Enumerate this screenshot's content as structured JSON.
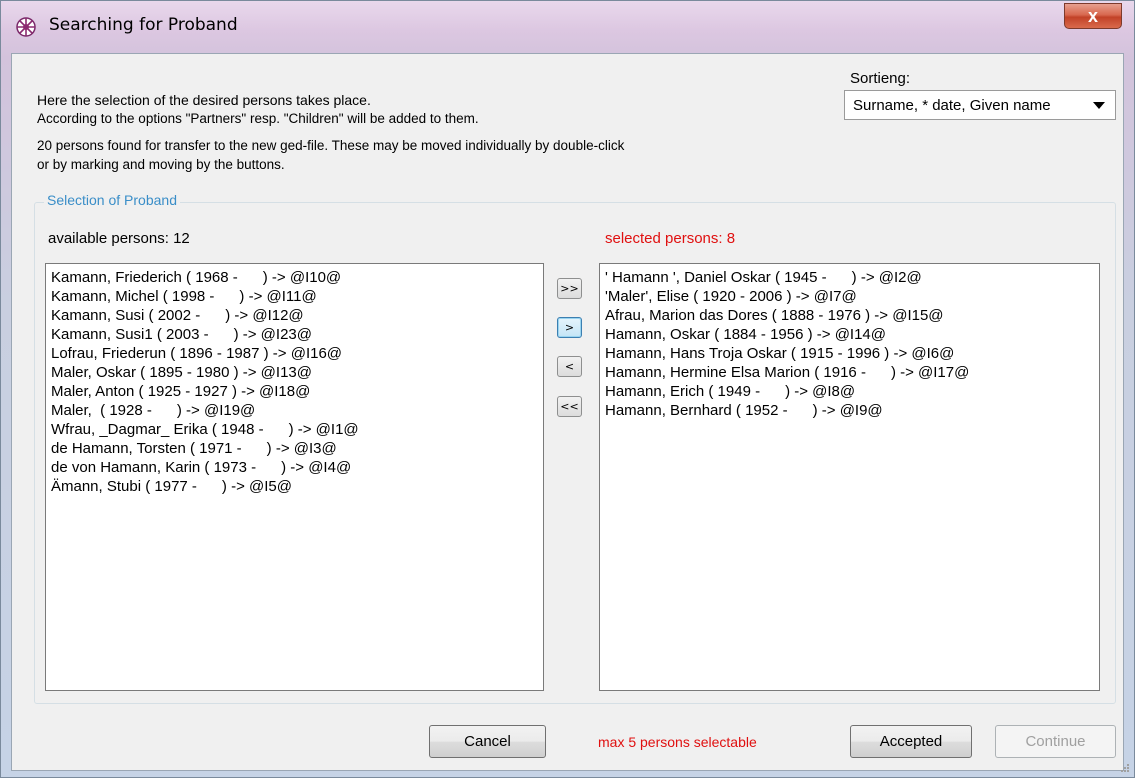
{
  "window": {
    "title": "Searching for Proband",
    "close_glyph": "x"
  },
  "info": {
    "line1": "Here the selection of the desired persons takes place.",
    "line2": "According to the options \"Partners\" resp. \"Children\" will be added to them.",
    "line3": "20 persons found for transfer to the new ged-file. These may be moved individually by double-click",
    "line4": "or by marking and moving by the buttons."
  },
  "sort": {
    "label": "Sortieng:",
    "value": "Surname, * date, Given name"
  },
  "group": {
    "title": "Selection of Proband"
  },
  "available": {
    "label": "available persons: 12",
    "items": [
      "Kamann, Friederich ( 1968 -      ) -> @I10@",
      "Kamann, Michel ( 1998 -      ) -> @I11@",
      "Kamann, Susi ( 2002 -      ) -> @I12@",
      "Kamann, Susi1 ( 2003 -      ) -> @I23@",
      "Lofrau, Friederun ( 1896 - 1987 ) -> @I16@",
      "Maler, Oskar ( 1895 - 1980 ) -> @I13@",
      "Maler, Anton ( 1925 - 1927 ) -> @I18@",
      "Maler,  ( 1928 -      ) -> @I19@",
      "Wfrau, _Dagmar_ Erika ( 1948 -      ) -> @I1@",
      "de Hamann, Torsten ( 1971 -      ) -> @I3@",
      "de von Hamann, Karin ( 1973 -      ) -> @I4@",
      "Ämann, Stubi ( 1977 -      ) -> @I5@"
    ]
  },
  "selected": {
    "label": "selected persons: 8",
    "label_color": "#e01010",
    "items": [
      "' Hamann ', Daniel Oskar ( 1945 -      ) -> @I2@",
      "'Maler', Elise ( 1920 - 2006 ) -> @I7@",
      "Afrau, Marion das Dores ( 1888 - 1976 ) -> @I15@",
      "Hamann, Oskar ( 1884 - 1956 ) -> @I14@",
      "Hamann, Hans Troja Oskar ( 1915 - 1996 ) -> @I6@",
      "Hamann, Hermine Elsa Marion ( 1916 -      ) -> @I17@",
      "Hamann, Erich ( 1949 -      ) -> @I8@",
      "Hamann, Bernhard ( 1952 -      ) -> @I9@"
    ]
  },
  "move_buttons": {
    "move_all_right": ">>",
    "move_right": ">",
    "move_left": "<",
    "move_all_left": "<<"
  },
  "footer": {
    "cancel_label": "Cancel",
    "max_text": "max 5 persons selectable",
    "accepted_label": "Accepted",
    "continue_label": "Continue"
  }
}
